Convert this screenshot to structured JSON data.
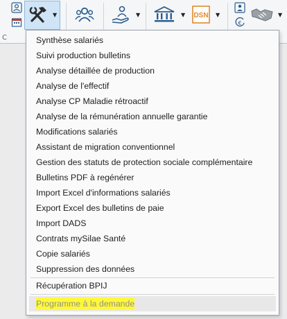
{
  "toolbar": {
    "group_label_left": "C",
    "tools": [
      {
        "name": "employee-schedule",
        "icon": "person-calendar-icon"
      },
      {
        "name": "tools",
        "icon": "hammer-wrench-icon",
        "active": true
      },
      {
        "name": "employees",
        "icon": "people-icon"
      },
      {
        "name": "payroll",
        "icon": "hand-person-icon"
      },
      {
        "name": "bank",
        "icon": "bank-icon"
      },
      {
        "name": "dsn",
        "icon": "dsn-icon",
        "label": "DSN"
      },
      {
        "name": "contact",
        "icon": "id-card-icon"
      },
      {
        "name": "handshake",
        "icon": "handshake-icon"
      }
    ]
  },
  "menu": {
    "items": [
      {
        "label": "Synthèse salariés"
      },
      {
        "label": "Suivi production bulletins"
      },
      {
        "label": "Analyse détaillée de production"
      },
      {
        "label": "Analyse de l'effectif"
      },
      {
        "label": "Analyse CP Maladie rétroactif"
      },
      {
        "label": "Analyse de la rémunération annuelle garantie"
      },
      {
        "label": "Modifications salariés"
      },
      {
        "label": "Assistant de migration conventionnel"
      },
      {
        "label": "Gestion des statuts de protection sociale complémentaire"
      },
      {
        "label": "Bulletins PDF à regénérer"
      },
      {
        "label": "Import Excel d'informations salariés"
      },
      {
        "label": "Export Excel des bulletins de paie"
      },
      {
        "label": "Import DADS"
      },
      {
        "label": "Contrats mySilae Santé"
      },
      {
        "label": "Copie salariés"
      },
      {
        "label": "Suppression des données"
      }
    ],
    "separated_item": {
      "label": "Récupération BPIJ"
    },
    "hovered_item": {
      "label": "Programme à la demande",
      "highlight_color": "#fff83a"
    }
  }
}
